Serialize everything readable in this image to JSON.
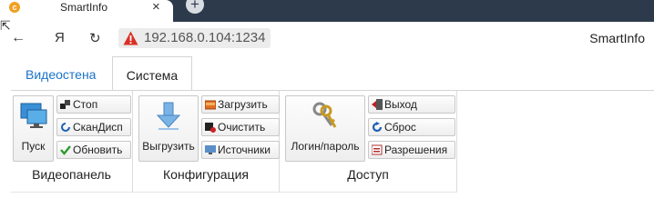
{
  "browser": {
    "tab_title": "SmartInfo",
    "tab_close": "×",
    "new_tab": "+",
    "back": "←",
    "forward": "Я",
    "reload": "↻",
    "url": "192.168.0.104:1234",
    "page_name": "SmartInfo",
    "cursor": "⇱"
  },
  "ribbon": {
    "tabs": [
      {
        "label": "Видеостена"
      },
      {
        "label": "Система"
      }
    ],
    "groups": {
      "videopanel": {
        "label": "Видеопанель",
        "big": {
          "label": "Пуск",
          "icon": "monitors-icon"
        },
        "small": [
          {
            "label": "Стоп",
            "icon": "stop-icon"
          },
          {
            "label": "СканДисп",
            "icon": "scan-icon"
          },
          {
            "label": "Обновить",
            "icon": "checkmark-icon"
          }
        ]
      },
      "config": {
        "label": "Конфигурация",
        "big": {
          "label": "Выгрузить",
          "icon": "download-arrow-icon"
        },
        "small": [
          {
            "label": "Загрузить",
            "icon": "upload-icon"
          },
          {
            "label": "Очистить",
            "icon": "clear-icon"
          },
          {
            "label": "Источники",
            "icon": "sources-icon"
          }
        ]
      },
      "access": {
        "label": "Доступ",
        "big": {
          "label": "Логин/пароль",
          "icon": "keys-icon"
        },
        "small": [
          {
            "label": "Выход",
            "icon": "exit-icon"
          },
          {
            "label": "Сброс",
            "icon": "reset-icon"
          },
          {
            "label": "Разрешения",
            "icon": "permissions-icon"
          }
        ]
      }
    }
  },
  "colors": {
    "tabstrip": "#2d3a4c",
    "link_tab": "#1a73c9",
    "warning": "#d93025"
  }
}
